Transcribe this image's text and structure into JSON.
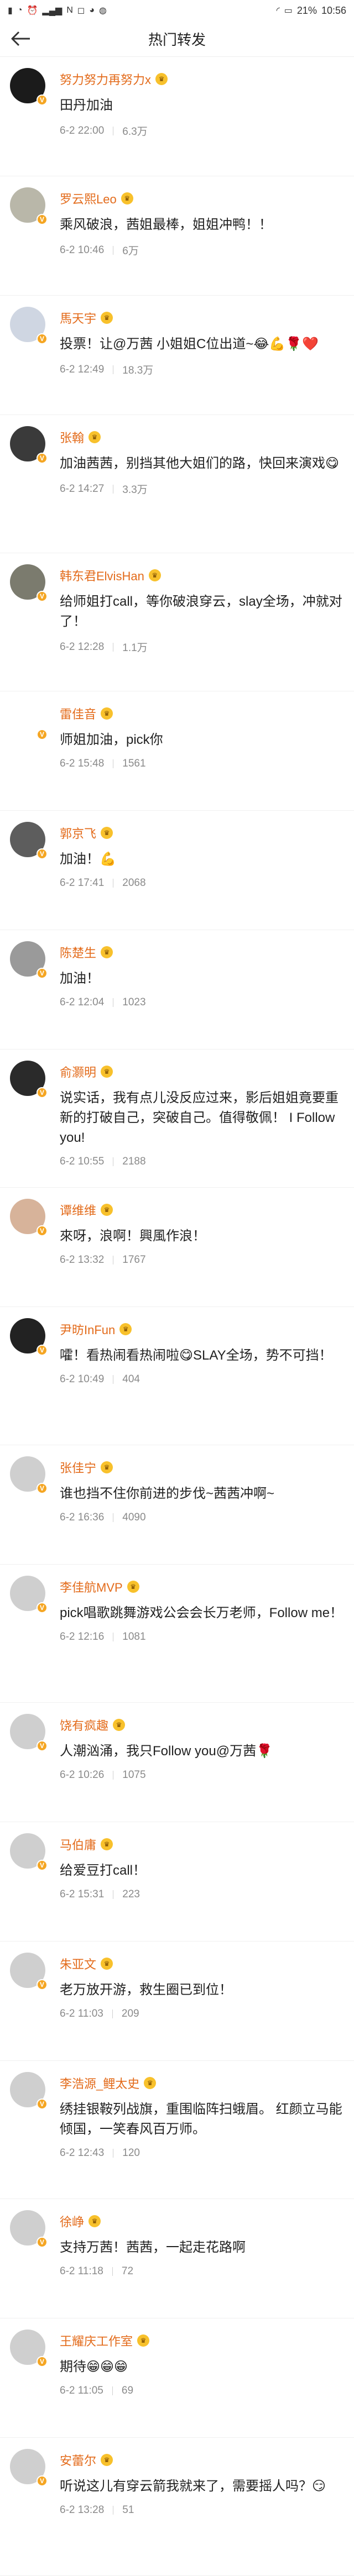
{
  "status_bar": {
    "left_icons": [
      "sim-icon",
      "wifi-icon",
      "alarm-icon",
      "signal-icon",
      "nfc-icon",
      "notification-icon",
      "wechat-icon",
      "weibo-icon"
    ],
    "battery": "21",
    "time": "10:56"
  },
  "header": {
    "title": "热门转发"
  },
  "items": [
    {
      "name": "努力努力再努力x",
      "text": "田丹加油",
      "time": "6-2 22:00",
      "count": "6.3万"
    },
    {
      "name": "罗云熙Leo",
      "text": "乘风破浪，茜姐最棒，姐姐冲鸭！！",
      "time": "6-2 10:46",
      "count": "6万"
    },
    {
      "name": "馬天宇",
      "text": "投票！让@万茜 小姐姐C位出道~😂💪🌹❤️",
      "time": "6-2 12:49",
      "count": "18.3万"
    },
    {
      "name": "张翰",
      "text": "加油茜茜，别挡其他大姐们的路，快回来演戏😋",
      "time": "6-2 14:27",
      "count": "3.3万"
    },
    {
      "name": "韩东君ElvisHan",
      "text": "给师姐打call，等你破浪穿云，slay全场，冲就对了！",
      "time": "6-2 12:28",
      "count": "1.1万"
    },
    {
      "name": "雷佳音",
      "text": "师姐加油，pick你",
      "time": "6-2 15:48",
      "count": "1561"
    },
    {
      "name": "郭京飞",
      "text": "加油！💪",
      "time": "6-2 17:41",
      "count": "2068"
    },
    {
      "name": "陈楚生",
      "text": "加油！",
      "time": "6-2 12:04",
      "count": "1023"
    },
    {
      "name": "俞灏明",
      "text": "说实话，我有点儿没反应过来，影后姐姐竟要重新的打破自己，突破自己。值得敬佩！ I Follow you!",
      "time": "6-2 10:55",
      "count": "2188"
    },
    {
      "name": "谭维维",
      "text": "來呀，浪啊！興風作浪！",
      "time": "6-2 13:32",
      "count": "1767"
    },
    {
      "name": "尹昉InFun",
      "text": "嚯！看热闹看热闹啦😋SLAY全场，势不可挡！",
      "time": "6-2 10:49",
      "count": "404"
    },
    {
      "name": "张佳宁",
      "text": "谁也挡不住你前进的步伐~茜茜冲啊~",
      "time": "6-2 16:36",
      "count": "4090"
    },
    {
      "name": "李佳航MVP",
      "text": "pick唱歌跳舞游戏公会会长万老师，Follow me！",
      "time": "6-2 12:16",
      "count": "1081"
    },
    {
      "name": "饶有疯趣",
      "text": "人潮汹涌，我只Follow you@万茜🌹",
      "time": "6-2 10:26",
      "count": "1075"
    },
    {
      "name": "马伯庸",
      "text": "给爱豆打call！",
      "time": "6-2 15:31",
      "count": "223"
    },
    {
      "name": "朱亚文",
      "text": "老万放开游，救生圈已到位！",
      "time": "6-2 11:03",
      "count": "209"
    },
    {
      "name": "李浩源_鲤太史",
      "text": "绣挂银鞍列战旗，重围临阵扫蛾眉。 红颜立马能倾国，一笑春风百万师。",
      "time": "6-2 12:43",
      "count": "120"
    },
    {
      "name": "徐峥",
      "text": "支持万茜！茜茜，一起走花路啊",
      "time": "6-2 11:18",
      "count": "72"
    },
    {
      "name": "王耀庆工作室",
      "text": "期待😁😁😁",
      "time": "6-2 11:05",
      "count": "69"
    },
    {
      "name": "安蕾尔",
      "text": "听说这儿有穿云箭我就来了，需要摇人吗？😏",
      "time": "6-2 13:28",
      "count": "51"
    }
  ]
}
